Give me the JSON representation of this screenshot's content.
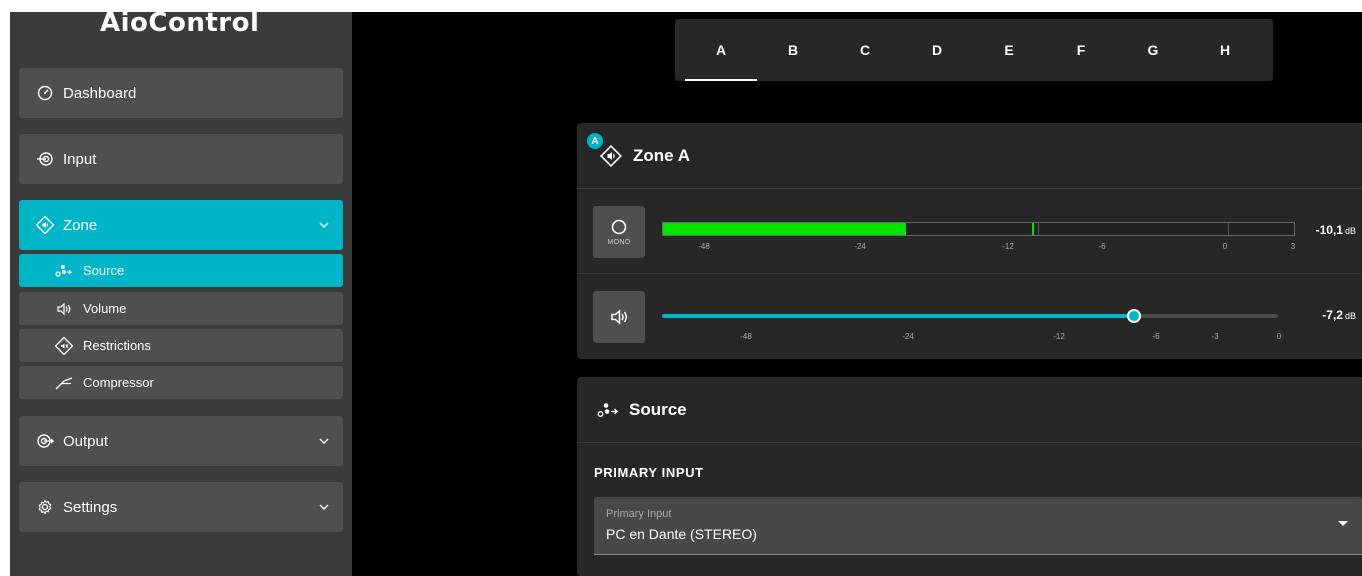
{
  "app": {
    "title": "AioControl"
  },
  "sidebar": {
    "items": [
      {
        "label": "Dashboard",
        "icon": "gauge-icon"
      },
      {
        "label": "Input",
        "icon": "input-icon"
      },
      {
        "label": "Zone",
        "icon": "zone-speaker-icon",
        "expanded": true
      },
      {
        "label": "Output",
        "icon": "output-icon"
      },
      {
        "label": "Settings",
        "icon": "gear-icon"
      }
    ],
    "zone_sub": [
      {
        "label": "Source",
        "icon": "source-nodes-icon",
        "active": true
      },
      {
        "label": "Volume",
        "icon": "volume-icon"
      },
      {
        "label": "Restrictions",
        "icon": "restrictions-icon"
      },
      {
        "label": "Compressor",
        "icon": "compressor-icon"
      }
    ]
  },
  "tabs": [
    "A",
    "B",
    "C",
    "D",
    "E",
    "F",
    "G",
    "H"
  ],
  "active_tab": "A",
  "zone_card": {
    "badge": "A",
    "title": "Zone A",
    "meter": {
      "mono_label": "MONO",
      "scale": [
        "-48",
        "-24",
        "-12",
        "-6",
        "0",
        "3"
      ],
      "level_db": "-10,1",
      "unit": "dB",
      "fill_fraction": 0.385,
      "peak_fraction": 0.585
    },
    "volume": {
      "scale": [
        "-48",
        "-24",
        "-12",
        "-6",
        "-3",
        "0"
      ],
      "value_db": "-7,2",
      "unit": "dB",
      "fraction": 0.766
    }
  },
  "source_card": {
    "title": "Source",
    "section_label": "PRIMARY INPUT",
    "select_label": "Primary Input",
    "select_value": "PC en Dante (STEREO)"
  },
  "colors": {
    "accent": "#00b5c8",
    "meter": "#00e600",
    "sidebar": "#3b3b3b",
    "card": "#272727"
  }
}
